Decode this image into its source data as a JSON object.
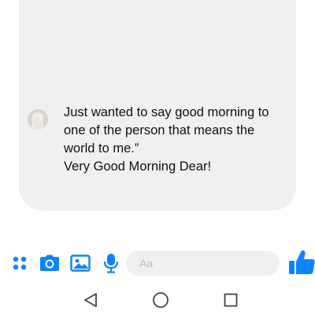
{
  "conversation": {
    "message": {
      "lines": [
        "Just wanted to say good morning to",
        "one of the person that means the",
        "world to me.”",
        "Very Good Morning Dear!"
      ]
    }
  },
  "composer": {
    "placeholder": "Aa",
    "icons": [
      "more-apps-icon",
      "camera-icon",
      "gallery-icon",
      "microphone-icon",
      "thumbs-up-icon"
    ]
  },
  "navbar": {
    "icons": [
      "back-triangle-icon",
      "home-circle-icon",
      "recents-square-icon"
    ]
  },
  "colors": {
    "accent": "#0a84ff",
    "bubble": "#f1f0f0",
    "nav": "#444444"
  }
}
